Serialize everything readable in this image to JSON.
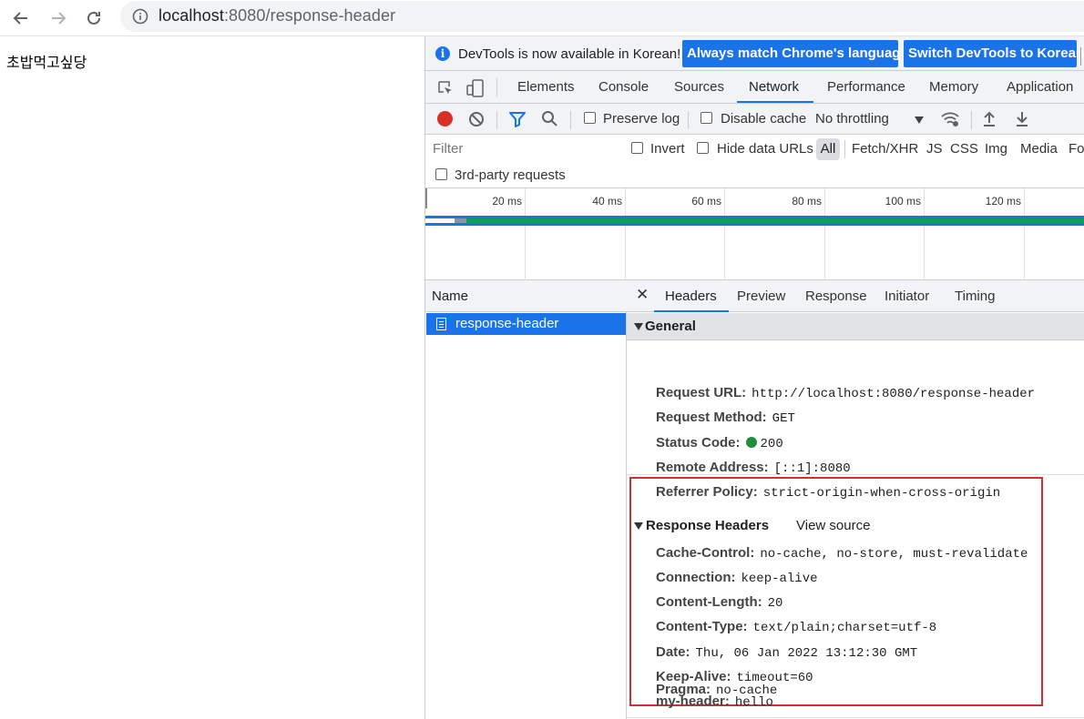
{
  "browser": {
    "url_host": "localhost",
    "url_rest": ":8080/response-header"
  },
  "page": {
    "body_text": "초밥먹고싶당"
  },
  "devtools": {
    "infobar": {
      "message": "DevTools is now available in Korean!",
      "match_button": "Always match Chrome's language",
      "switch_button": "Switch DevTools to Korean"
    },
    "tabs": [
      "Elements",
      "Console",
      "Sources",
      "Network",
      "Performance",
      "Memory",
      "Application"
    ],
    "active_tab": "Network",
    "toolbar": {
      "preserve_log": "Preserve log",
      "disable_cache": "Disable cache",
      "throttling": "No throttling"
    },
    "filter": {
      "placeholder": "Filter",
      "invert": "Invert",
      "hide_data_urls": "Hide data URLs",
      "types": [
        "All",
        "Fetch/XHR",
        "JS",
        "CSS",
        "Img",
        "Media",
        "Fo"
      ],
      "third_party": "3rd-party requests"
    },
    "timeline": {
      "ticks": [
        "20 ms",
        "40 ms",
        "60 ms",
        "80 ms",
        "100 ms",
        "120 ms"
      ]
    },
    "request_list": {
      "header": "Name",
      "items": [
        "response-header"
      ]
    },
    "detail": {
      "tabs": [
        "Headers",
        "Preview",
        "Response",
        "Initiator",
        "Timing"
      ],
      "active_tab": "Headers",
      "general": {
        "title": "General",
        "rows": [
          {
            "key": "Request URL:",
            "value": "http://localhost:8080/response-header"
          },
          {
            "key": "Request Method:",
            "value": "GET"
          },
          {
            "key": "Status Code:",
            "value": "200"
          },
          {
            "key": "Remote Address:",
            "value": "[::1]:8080"
          },
          {
            "key": "Referrer Policy:",
            "value": "strict-origin-when-cross-origin"
          }
        ]
      },
      "response_headers": {
        "title": "Response Headers",
        "view_source": "View source",
        "rows": [
          {
            "key": "Cache-Control:",
            "value": "no-cache, no-store, must-revalidate"
          },
          {
            "key": "Connection:",
            "value": "keep-alive"
          },
          {
            "key": "Content-Length:",
            "value": "20"
          },
          {
            "key": "Content-Type:",
            "value": "text/plain;charset=utf-8"
          },
          {
            "key": "Date:",
            "value": "Thu, 06 Jan 2022 13:12:30 GMT"
          },
          {
            "key": "Keep-Alive:",
            "value": "timeout=60"
          },
          {
            "key": "my-header:",
            "value": "hello"
          },
          {
            "key": "Pragma:",
            "value": "no-cache"
          }
        ]
      }
    }
  },
  "colors": {
    "accent": "#1a73e8",
    "record": "#d93025",
    "status_ok": "#1e8e3e",
    "highlight_box": "#d32f2f"
  }
}
